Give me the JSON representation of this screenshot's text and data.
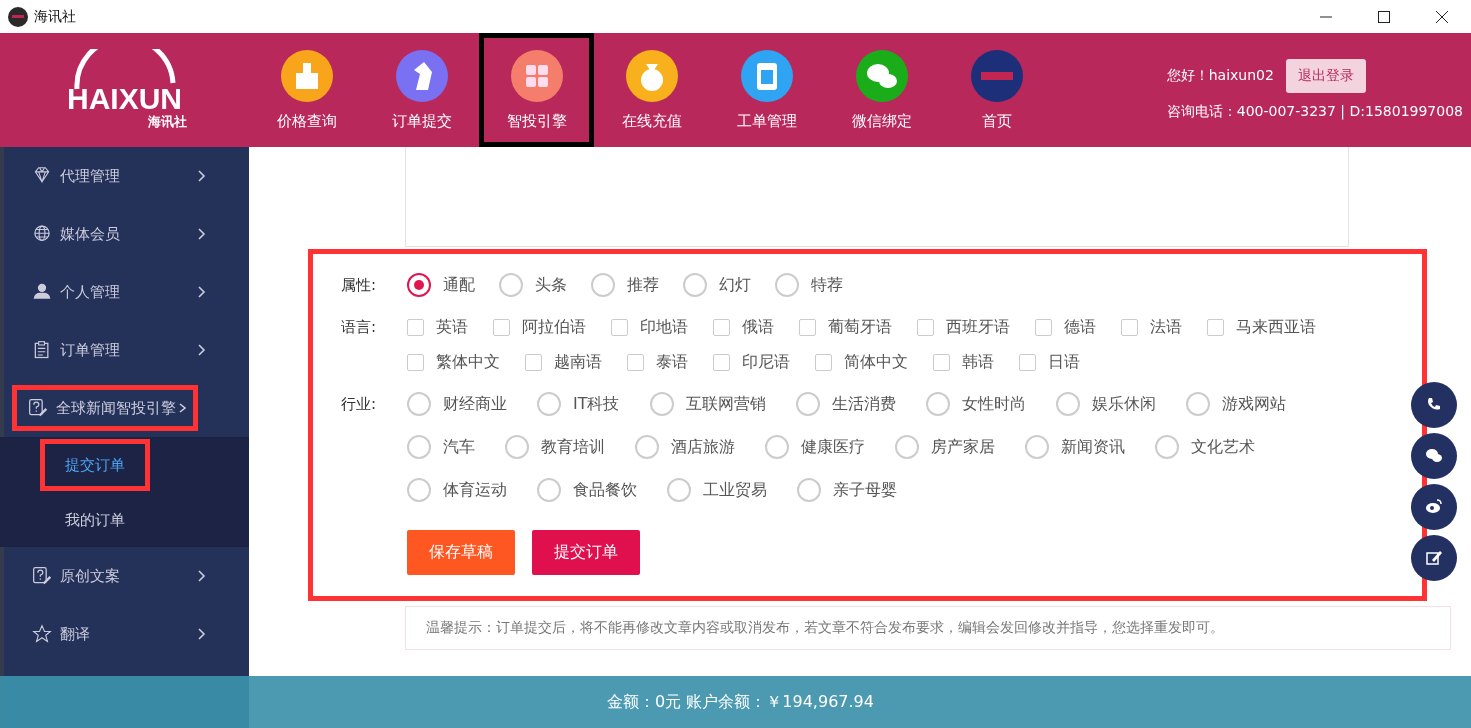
{
  "window": {
    "title": "海讯社"
  },
  "header": {
    "logo_wordmark": "HAIXUN",
    "logo_text": "海讯社",
    "nav": [
      {
        "label": "价格查询",
        "selected": false
      },
      {
        "label": "订单提交",
        "selected": false
      },
      {
        "label": "智投引擎",
        "selected": true
      },
      {
        "label": "在线充值",
        "selected": false
      },
      {
        "label": "工单管理",
        "selected": false
      },
      {
        "label": "微信绑定",
        "selected": false
      },
      {
        "label": "首页",
        "selected": false
      }
    ],
    "greeting": "您好！haixun02",
    "logout": "退出登录",
    "contact": "咨询电话：400-007-3237 | D:15801997008"
  },
  "sidebar": {
    "items": [
      {
        "label": "代理管理",
        "expanded": false,
        "highlighted": false
      },
      {
        "label": "媒体会员",
        "expanded": false,
        "highlighted": false
      },
      {
        "label": "个人管理",
        "expanded": false,
        "highlighted": false
      },
      {
        "label": "订单管理",
        "expanded": false,
        "highlighted": false
      },
      {
        "label": "全球新闻智投引擎",
        "expanded": true,
        "highlighted": true,
        "children": [
          {
            "label": "提交订单",
            "selected": true,
            "highlighted": true
          },
          {
            "label": "我的订单",
            "selected": false,
            "highlighted": false
          }
        ]
      },
      {
        "label": "原创文案",
        "expanded": false,
        "highlighted": false
      },
      {
        "label": "翻译",
        "expanded": false,
        "highlighted": false
      }
    ]
  },
  "form": {
    "highlighted": true,
    "attribute": {
      "label": "属性:",
      "options": [
        {
          "label": "通配",
          "selected": true
        },
        {
          "label": "头条",
          "selected": false
        },
        {
          "label": "推荐",
          "selected": false
        },
        {
          "label": "幻灯",
          "selected": false
        },
        {
          "label": "特荐",
          "selected": false
        }
      ]
    },
    "language": {
      "label": "语言:",
      "options": [
        {
          "label": "英语",
          "checked": false
        },
        {
          "label": "阿拉伯语",
          "checked": false
        },
        {
          "label": "印地语",
          "checked": false
        },
        {
          "label": "俄语",
          "checked": false
        },
        {
          "label": "葡萄牙语",
          "checked": false
        },
        {
          "label": "西班牙语",
          "checked": false
        },
        {
          "label": "德语",
          "checked": false
        },
        {
          "label": "法语",
          "checked": false
        },
        {
          "label": "马来西亚语",
          "checked": false
        },
        {
          "label": "繁体中文",
          "checked": false
        },
        {
          "label": "越南语",
          "checked": false
        },
        {
          "label": "泰语",
          "checked": false
        },
        {
          "label": "印尼语",
          "checked": false
        },
        {
          "label": "简体中文",
          "checked": false
        },
        {
          "label": "韩语",
          "checked": false
        },
        {
          "label": "日语",
          "checked": false
        }
      ]
    },
    "industry": {
      "label": "行业:",
      "options": [
        {
          "label": "财经商业",
          "selected": false
        },
        {
          "label": "IT科技",
          "selected": false
        },
        {
          "label": "互联网营销",
          "selected": false
        },
        {
          "label": "生活消费",
          "selected": false
        },
        {
          "label": "女性时尚",
          "selected": false
        },
        {
          "label": "娱乐休闲",
          "selected": false
        },
        {
          "label": "游戏网站",
          "selected": false
        },
        {
          "label": "汽车",
          "selected": false
        },
        {
          "label": "教育培训",
          "selected": false
        },
        {
          "label": "酒店旅游",
          "selected": false
        },
        {
          "label": "健康医疗",
          "selected": false
        },
        {
          "label": "房产家居",
          "selected": false
        },
        {
          "label": "新闻资讯",
          "selected": false
        },
        {
          "label": "文化艺术",
          "selected": false
        },
        {
          "label": "体育运动",
          "selected": false
        },
        {
          "label": "食品餐饮",
          "selected": false
        },
        {
          "label": "工业贸易",
          "selected": false
        },
        {
          "label": "亲子母婴",
          "selected": false
        }
      ]
    },
    "buttons": [
      {
        "label": "保存草稿",
        "kind": "draft"
      },
      {
        "label": "提交订单",
        "kind": "submit"
      }
    ]
  },
  "hint": "温馨提示：订单提交后，将不能再修改文章内容或取消发布，若文章不符合发布要求，编辑会发回修改并指导，您选择重发即可。",
  "footer": {
    "amount": "金额：0元 账户余额：￥194,967.94"
  }
}
